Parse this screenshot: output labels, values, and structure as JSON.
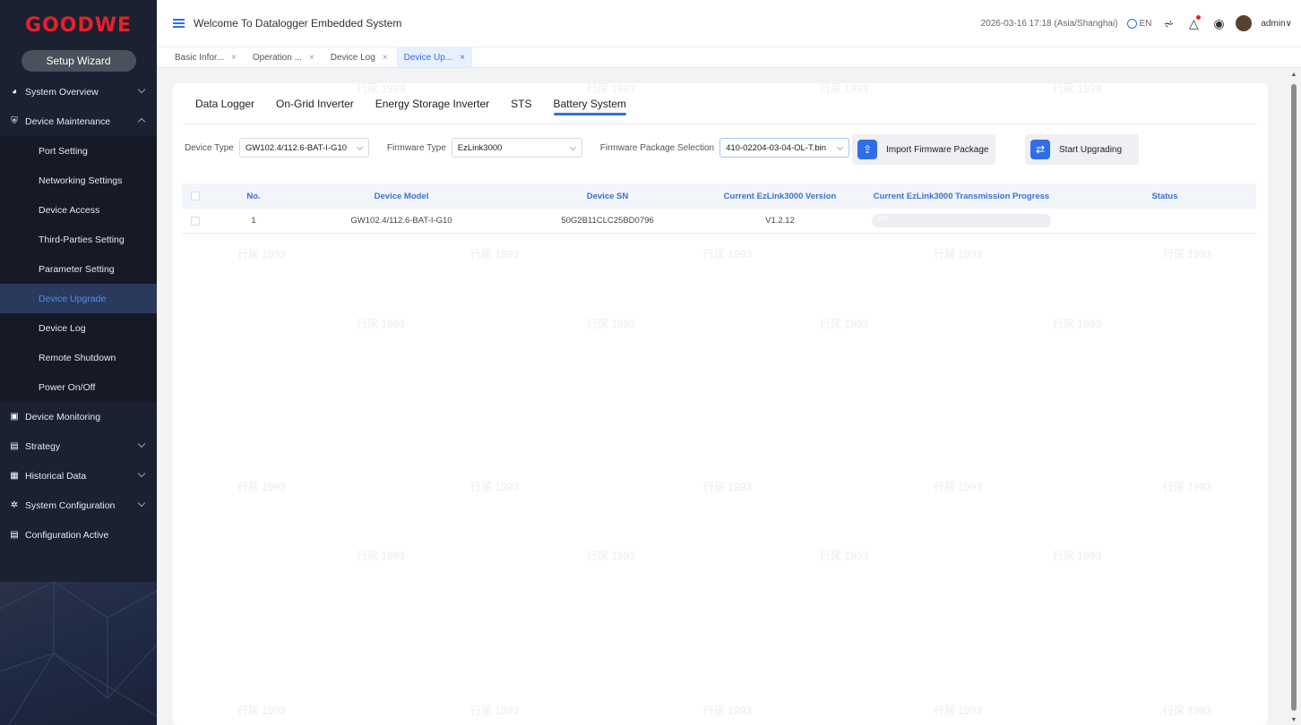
{
  "brand": {
    "logo_text": "GOODWE",
    "logo_color": "#e8202a"
  },
  "sidebar": {
    "setup_wizard": "Setup Wizard",
    "items": [
      {
        "label": "System Overview",
        "icon": "pie-chart-icon",
        "expandable": true
      },
      {
        "label": "Device Maintenance",
        "icon": "shield-icon",
        "expandable": true,
        "expanded": true
      }
    ],
    "maintenance_sub": [
      "Port Setting",
      "Networking Settings",
      "Device Access",
      "Third-Parties Setting",
      "Parameter Setting",
      "Device Upgrade",
      "Device Log",
      "Remote Shutdown",
      "Power On/Off"
    ],
    "active_sub": "Device Upgrade",
    "more_items": [
      {
        "label": "Device Monitoring",
        "icon": "monitor-icon"
      },
      {
        "label": "Strategy",
        "icon": "strategy-icon"
      },
      {
        "label": "Historical Data",
        "icon": "history-icon"
      },
      {
        "label": "System Configuration",
        "icon": "gear-icon"
      },
      {
        "label": "Configuration Active",
        "icon": "config-icon"
      }
    ]
  },
  "header": {
    "title": "Welcome To Datalogger Embedded System",
    "datetime": "2026-03-16 17:18 (Asia/Shanghai)",
    "language": "EN",
    "user": "admin"
  },
  "page_tabs": [
    {
      "label": "Basic Infor...",
      "active": false
    },
    {
      "label": "Operation ...",
      "active": false
    },
    {
      "label": "Device Log",
      "active": false
    },
    {
      "label": "Device Up...",
      "active": true
    }
  ],
  "subtabs": [
    "Data Logger",
    "On-Grid Inverter",
    "Energy Storage Inverter",
    "STS",
    "Battery System"
  ],
  "active_subtab": "Battery System",
  "filters": {
    "device_type_label": "Device Type",
    "device_type_value": "GW102.4/112.6-BAT-I-G10",
    "firmware_type_label": "Firmware Type",
    "firmware_type_value": "EzLink3000",
    "package_label": "Firmware Package Selection",
    "package_value": "410-02204-03-04-OL-T.bin"
  },
  "buttons": {
    "import": "Import Firmware Package",
    "start": "Start Upgrading"
  },
  "table": {
    "headers": [
      "No.",
      "Device Model",
      "Device SN",
      "Current EzLink3000 Version",
      "Current EzLink3000 Transmission Progress",
      "Status"
    ],
    "rows": [
      {
        "no": "1",
        "model": "GW102.4/112.6-BAT-I-G10",
        "sn": "50G2B11CLC25BD0796",
        "version": "V1.2.12",
        "progress_text": "0%",
        "progress": 0,
        "status": ""
      }
    ]
  },
  "watermark": "行尿 1993",
  "colors": {
    "accent": "#2f6ee8",
    "sidebar_bg": "#1b2131",
    "active_bg": "#2a3a5c"
  }
}
